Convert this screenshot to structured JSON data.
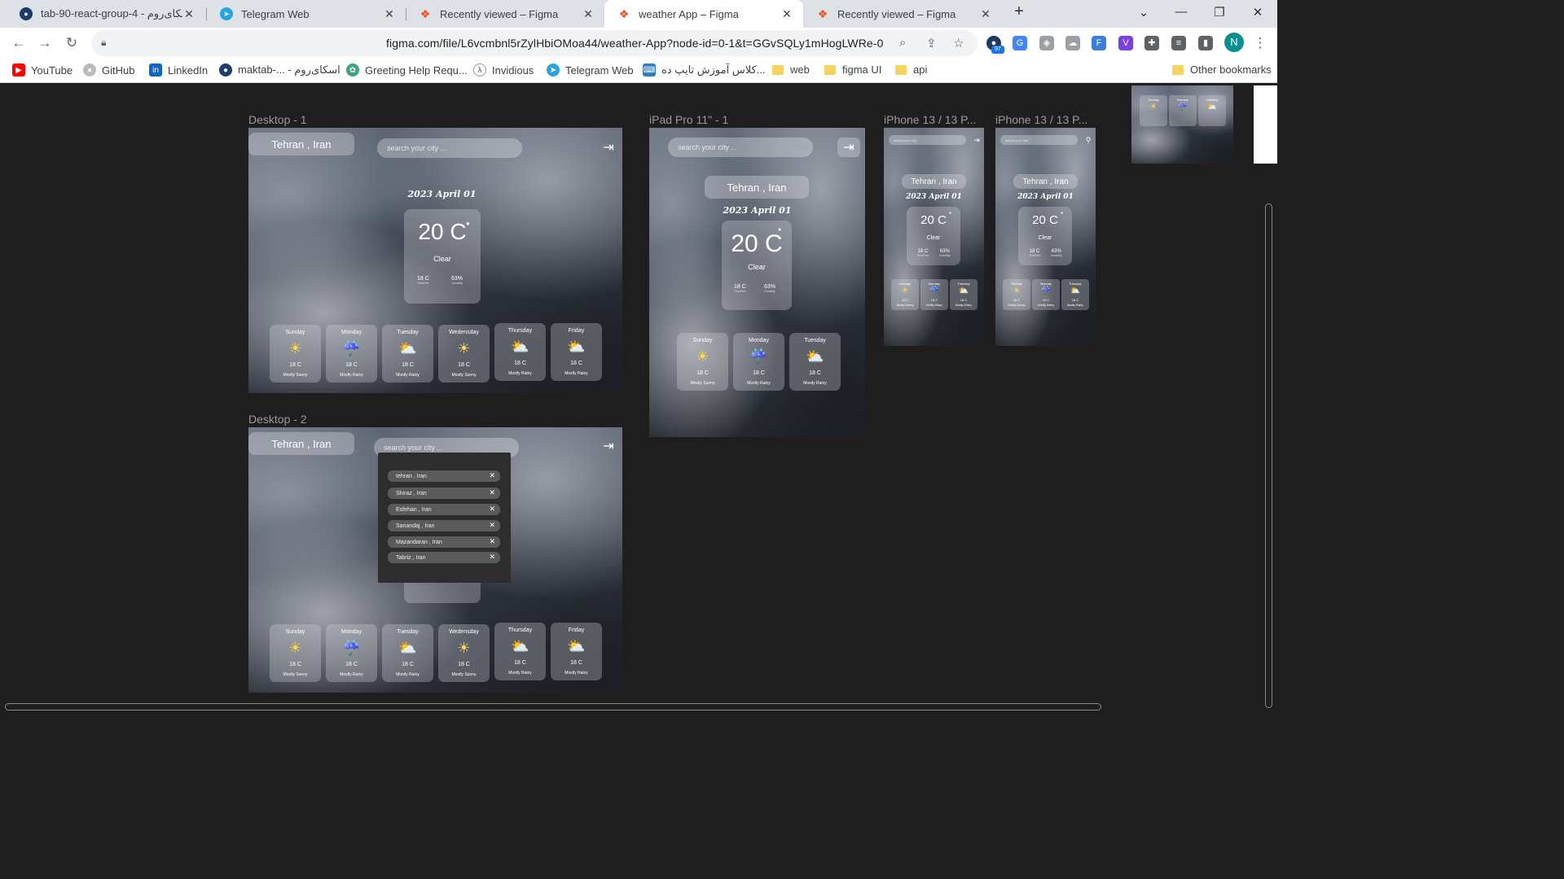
{
  "browser": {
    "tabs": [
      {
        "title": "tab-90-react-group-4 - اسکای‌روم",
        "active": false
      },
      {
        "title": "Telegram Web",
        "active": false
      },
      {
        "title": "Recently viewed – Figma",
        "active": false
      },
      {
        "title": "weather App – Figma",
        "active": true
      },
      {
        "title": "Recently viewed – Figma",
        "active": false
      }
    ],
    "new_tab_symbol": "+",
    "url": "figma.com/file/L6vcmbnl5rZylHbiOMoa44/weather-App?node-id=0-1&t=GGvSQLy1mHogLWRe-0",
    "extension_badge": "97",
    "profile_initial": "N",
    "bookmarks": [
      "YouTube",
      "GitHub",
      "LinkedIn",
      "maktab-... - اسکای‌روم",
      "Greeting Help Requ...",
      "Invidious",
      "Telegram Web",
      "کلاس آموزش تایپ ده...",
      "web",
      "figma UI",
      "api"
    ],
    "other_bookmarks": "Other bookmarks"
  },
  "frames": {
    "desktop1": {
      "label": "Desktop - 1"
    },
    "desktop2": {
      "label": "Desktop - 2"
    },
    "ipad": {
      "label": "iPad Pro 11\" - 1"
    },
    "iphone1": {
      "label": "iPhone 13 / 13 P..."
    },
    "iphone2": {
      "label": "iPhone 13 / 13 P..."
    }
  },
  "weather": {
    "city": "Tehran , Iran",
    "search_placeholder": "search your city ...",
    "date": "2023 April 01",
    "temp": "20 C",
    "condition": "Clear",
    "realfeel": "18 C",
    "realfeel_label": "RealFeel",
    "humidity": "63%",
    "humidity_label": "Humidity",
    "forecast": [
      {
        "day": "Sunday",
        "temp": "18 C",
        "summary": "Mostly Sunny",
        "icon": "sun-icon"
      },
      {
        "day": "Monday",
        "temp": "18 C",
        "summary": "Mostly Rainy",
        "icon": "rain-cloud-icon"
      },
      {
        "day": "Tuesday",
        "temp": "18 C",
        "summary": "Mostly Rainy",
        "icon": "sun-cloud-icon"
      },
      {
        "day": "Wedensday",
        "temp": "18 C",
        "summary": "Mostly Sunny",
        "icon": "sun-icon"
      },
      {
        "day": "Thursday",
        "temp": "18 C",
        "summary": "Mostly Rainy",
        "icon": "sun-cloud-icon"
      },
      {
        "day": "Friday",
        "temp": "18 C",
        "summary": "Mostly Rainy",
        "icon": "sun-cloud-icon"
      }
    ],
    "search_results": [
      "tehran , Iran",
      "Shiraz , Iran",
      "Esfehan , Iran",
      "Sanandaj , Iran",
      "Mazandaran , Iran",
      "Tabriz , Iran"
    ]
  }
}
